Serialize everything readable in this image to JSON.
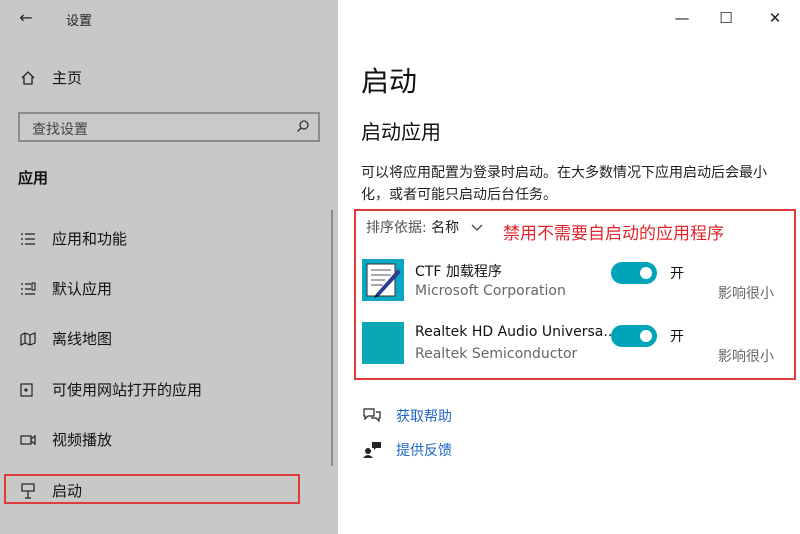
{
  "window": {
    "title": "设置",
    "back_icon": "←",
    "minimize_icon": "—",
    "maximize_icon": "☐",
    "close_icon": "✕"
  },
  "sidebar": {
    "home_label": "主页",
    "search_placeholder": "查找设置",
    "section_title": "应用",
    "items": [
      {
        "label": "应用和功能",
        "icon": "list-icon"
      },
      {
        "label": "默认应用",
        "icon": "default-apps-icon"
      },
      {
        "label": "离线地图",
        "icon": "map-icon"
      },
      {
        "label": "可使用网站打开的应用",
        "icon": "website-apps-icon"
      },
      {
        "label": "视频播放",
        "icon": "video-icon"
      },
      {
        "label": "启动",
        "icon": "startup-icon"
      }
    ]
  },
  "main": {
    "title": "启动",
    "subtitle": "启动应用",
    "description": "可以将应用配置为登录时启动。在大多数情况下应用启动后会最小化，或者可能只启动后台任务。",
    "sort_label": "排序依据:",
    "sort_value": "名称",
    "annotation": "禁用不需要自启动的应用程序",
    "apps": [
      {
        "name": "CTF 加载程序",
        "publisher": "Microsoft Corporation",
        "state": "开",
        "impact": "影响很小",
        "enabled": true
      },
      {
        "name": "Realtek HD Audio Universa...",
        "publisher": "Realtek Semiconductor",
        "state": "开",
        "impact": "影响很小",
        "enabled": true
      }
    ],
    "links": {
      "help": "获取帮助",
      "feedback": "提供反馈"
    }
  },
  "colors": {
    "accent": "#00a4b8",
    "annotation_red": "#e0262b",
    "link_blue": "#1e66c8",
    "sidebar_bg": "#c8c8c6"
  }
}
